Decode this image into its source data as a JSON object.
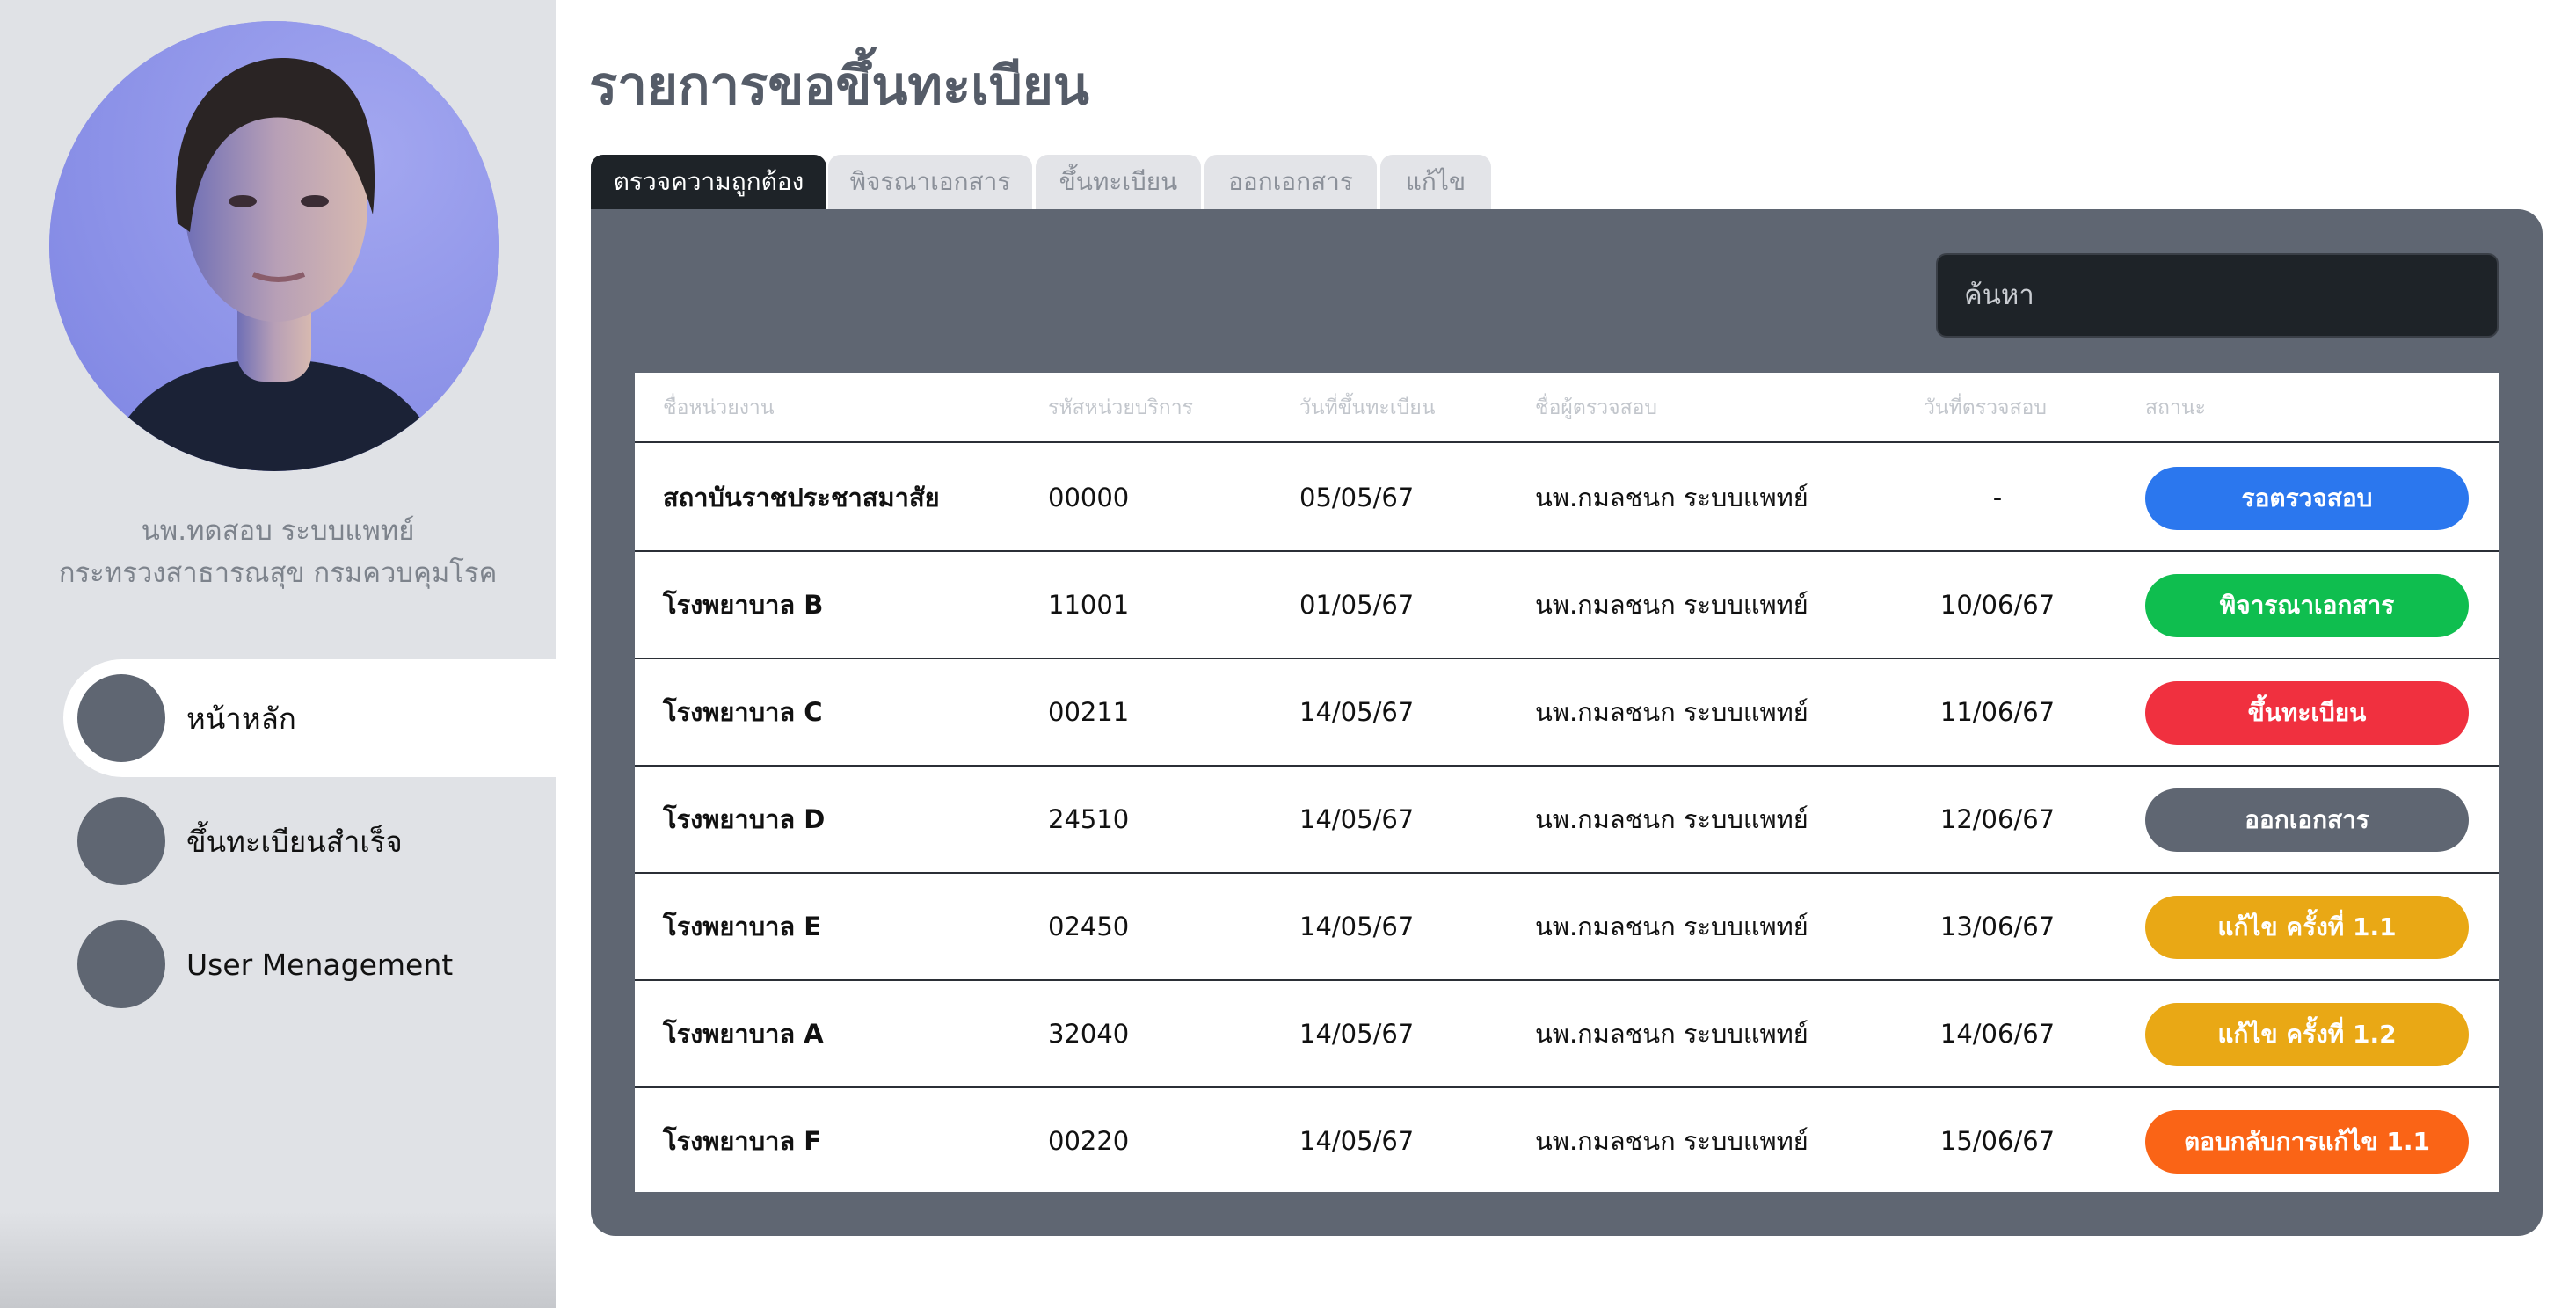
{
  "sidebar": {
    "user_name": "นพ.ทดสอบ ระบบแพทย์",
    "user_org": "กระทรวงสาธารณสุข กรมควบคุมโรค",
    "items": [
      {
        "label": "หน้าหลัก",
        "active": true
      },
      {
        "label": "ขึ้นทะเบียนสำเร็จ",
        "active": false
      },
      {
        "label": "User Menagement",
        "active": false
      }
    ]
  },
  "main": {
    "title": "รายการขอขึ้นทะเบียน",
    "tabs": [
      {
        "label": "ตรวจความถูกต้อง",
        "active": true
      },
      {
        "label": "พิจรณาเอกสาร",
        "active": false
      },
      {
        "label": "ขึ้นทะเบียน",
        "active": false
      },
      {
        "label": "ออกเอกสาร",
        "active": false
      },
      {
        "label": "แก้ไข",
        "active": false
      }
    ],
    "search": {
      "placeholder": "ค้นหา"
    },
    "table": {
      "headers": [
        "ชื่อหน่วยงาน",
        "รหัสหน่วยบริการ",
        "วันที่ขึ้นทะเบียน",
        "ชื่อผู้ตรวจสอบ",
        "วันที่ตรวจสอบ",
        "สถานะ"
      ],
      "rows": [
        {
          "name": "สถาบันราชประชาสมาสัย",
          "code": "00000",
          "reg_date": "05/05/67",
          "inspector": "นพ.กมลชนก ระบบแพทย์",
          "check_date": "-",
          "status": "รอตรวจสอบ",
          "status_color": "#2b77ee"
        },
        {
          "name": "โรงพยาบาล B",
          "code": "11001",
          "reg_date": "01/05/67",
          "inspector": "นพ.กมลชนก ระบบแพทย์",
          "check_date": "10/06/67",
          "status": "พิจารณาเอกสาร",
          "status_color": "#0fbe4f"
        },
        {
          "name": "โรงพยาบาล C",
          "code": "00211",
          "reg_date": "14/05/67",
          "inspector": "นพ.กมลชนก ระบบแพทย์",
          "check_date": "11/06/67",
          "status": "ขึ้นทะเบียน",
          "status_color": "#f0303f"
        },
        {
          "name": "โรงพยาบาล D",
          "code": "24510",
          "reg_date": "14/05/67",
          "inspector": "นพ.กมลชนก ระบบแพทย์",
          "check_date": "12/06/67",
          "status": "ออกเอกสาร",
          "status_color": "#5f6672"
        },
        {
          "name": "โรงพยาบาล E",
          "code": "02450",
          "reg_date": "14/05/67",
          "inspector": "นพ.กมลชนก ระบบแพทย์",
          "check_date": "13/06/67",
          "status": "แก้ไข ครั้งที่ 1.1",
          "status_color": "#e9a815"
        },
        {
          "name": "โรงพยาบาล A",
          "code": "32040",
          "reg_date": "14/05/67",
          "inspector": "นพ.กมลชนก ระบบแพทย์",
          "check_date": "14/06/67",
          "status": "แก้ไข ครั้งที่ 1.2",
          "status_color": "#e9a815"
        },
        {
          "name": "โรงพยาบาล F",
          "code": "00220",
          "reg_date": "14/05/67",
          "inspector": "นพ.กมลชนก ระบบแพทย์",
          "check_date": "15/06/67",
          "status": "ตอบกลับการแก้ไข 1.1",
          "status_color": "#fa6416"
        }
      ]
    }
  }
}
